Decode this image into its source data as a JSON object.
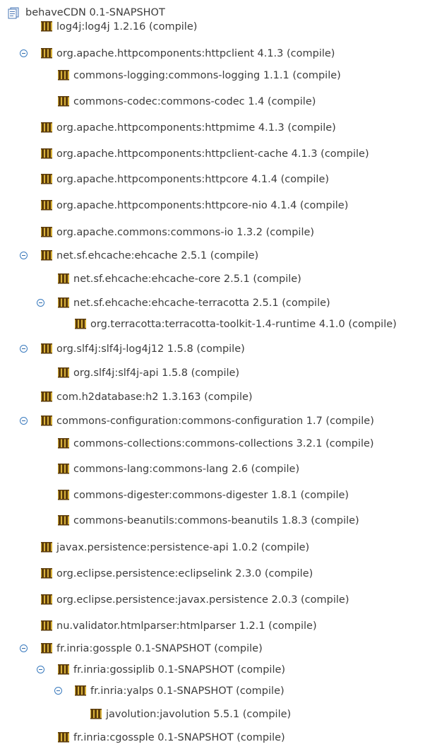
{
  "tree": {
    "root": {
      "label": "behaveCDN 0.1-SNAPSHOT",
      "icon": "maven-project-icon"
    },
    "nodes": [
      {
        "id": "log4j",
        "label": "log4j:log4j 1.2.16 (compile)",
        "level": 1,
        "expandable": false
      },
      {
        "id": "httpclient",
        "label": "org.apache.httpcomponents:httpclient 4.1.3 (compile)",
        "level": 1,
        "expandable": true,
        "expanded": true
      },
      {
        "id": "commons-logging",
        "label": "commons-logging:commons-logging 1.1.1 (compile)",
        "level": 2,
        "expandable": false
      },
      {
        "id": "commons-codec",
        "label": "commons-codec:commons-codec 1.4 (compile)",
        "level": 2,
        "expandable": false
      },
      {
        "id": "httpmime",
        "label": "org.apache.httpcomponents:httpmime 4.1.3 (compile)",
        "level": 1,
        "expandable": false
      },
      {
        "id": "httpclient-cache",
        "label": "org.apache.httpcomponents:httpclient-cache 4.1.3 (compile)",
        "level": 1,
        "expandable": false
      },
      {
        "id": "httpcore",
        "label": "org.apache.httpcomponents:httpcore 4.1.4 (compile)",
        "level": 1,
        "expandable": false
      },
      {
        "id": "httpcore-nio",
        "label": "org.apache.httpcomponents:httpcore-nio 4.1.4 (compile)",
        "level": 1,
        "expandable": false
      },
      {
        "id": "commons-io",
        "label": "org.apache.commons:commons-io 1.3.2 (compile)",
        "level": 1,
        "expandable": false
      },
      {
        "id": "ehcache",
        "label": "net.sf.ehcache:ehcache 2.5.1 (compile)",
        "level": 1,
        "expandable": true,
        "expanded": true
      },
      {
        "id": "ehcache-core",
        "label": "net.sf.ehcache:ehcache-core 2.5.1 (compile)",
        "level": 2,
        "expandable": false
      },
      {
        "id": "ehcache-terracotta",
        "label": "net.sf.ehcache:ehcache-terracotta 2.5.1 (compile)",
        "level": 2,
        "expandable": true,
        "expanded": true
      },
      {
        "id": "terracotta-toolkit",
        "label": "org.terracotta:terracotta-toolkit-1.4-runtime 4.1.0 (compile)",
        "level": 3,
        "expandable": false
      },
      {
        "id": "slf4j-log4j12",
        "label": "org.slf4j:slf4j-log4j12 1.5.8 (compile)",
        "level": 1,
        "expandable": true,
        "expanded": true
      },
      {
        "id": "slf4j-api",
        "label": "org.slf4j:slf4j-api 1.5.8 (compile)",
        "level": 2,
        "expandable": false
      },
      {
        "id": "h2",
        "label": "com.h2database:h2 1.3.163 (compile)",
        "level": 1,
        "expandable": false
      },
      {
        "id": "commons-configuration",
        "label": "commons-configuration:commons-configuration 1.7 (compile)",
        "level": 1,
        "expandable": true,
        "expanded": true
      },
      {
        "id": "commons-collections",
        "label": "commons-collections:commons-collections 3.2.1 (compile)",
        "level": 2,
        "expandable": false
      },
      {
        "id": "commons-lang",
        "label": "commons-lang:commons-lang 2.6 (compile)",
        "level": 2,
        "expandable": false
      },
      {
        "id": "commons-digester",
        "label": "commons-digester:commons-digester 1.8.1 (compile)",
        "level": 2,
        "expandable": false
      },
      {
        "id": "commons-beanutils",
        "label": "commons-beanutils:commons-beanutils 1.8.3 (compile)",
        "level": 2,
        "expandable": false
      },
      {
        "id": "persistence-api",
        "label": "javax.persistence:persistence-api 1.0.2 (compile)",
        "level": 1,
        "expandable": false
      },
      {
        "id": "eclipselink",
        "label": "org.eclipse.persistence:eclipselink 2.3.0 (compile)",
        "level": 1,
        "expandable": false
      },
      {
        "id": "javax-persistence",
        "label": "org.eclipse.persistence:javax.persistence 2.0.3 (compile)",
        "level": 1,
        "expandable": false
      },
      {
        "id": "htmlparser",
        "label": "nu.validator.htmlparser:htmlparser 1.2.1 (compile)",
        "level": 1,
        "expandable": false
      },
      {
        "id": "gossple",
        "label": "fr.inria:gossple 0.1-SNAPSHOT (compile)",
        "level": 1,
        "expandable": true,
        "expanded": true
      },
      {
        "id": "gossiplib",
        "label": "fr.inria:gossiplib 0.1-SNAPSHOT (compile)",
        "level": 2,
        "expandable": true,
        "expanded": true
      },
      {
        "id": "yalps",
        "label": "fr.inria:yalps 0.1-SNAPSHOT (compile)",
        "level": 3,
        "expandable": true,
        "expanded": true
      },
      {
        "id": "javolution",
        "label": "javolution:javolution 5.5.1 (compile)",
        "level": 4,
        "expandable": false
      },
      {
        "id": "cgossple",
        "label": "fr.inria:cgossple 0.1-SNAPSHOT (compile)",
        "level": 2,
        "expandable": false
      }
    ]
  },
  "colors": {
    "text": "#3c3c3c",
    "toggle_border": "#3a7bbf",
    "jar_dark": "#5b3b0a",
    "jar_light": "#d9b23a"
  }
}
